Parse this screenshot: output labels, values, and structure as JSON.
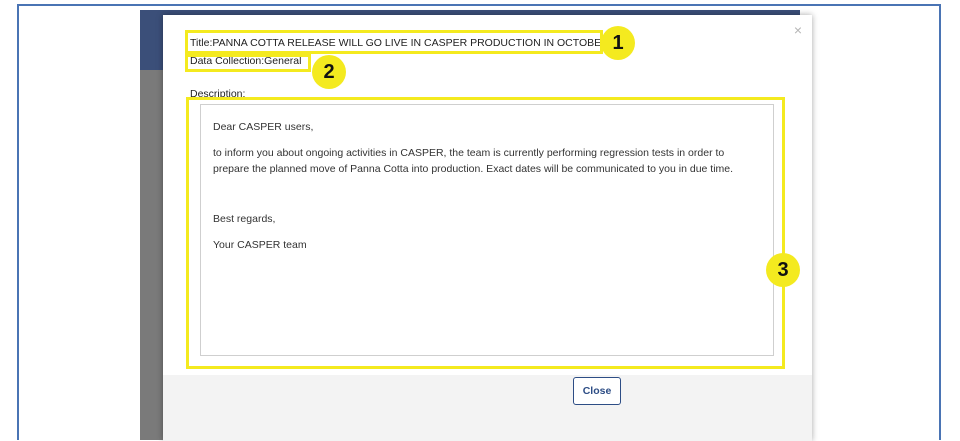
{
  "notice": {
    "title_prefix": "Title:",
    "title_value": "PANNA COTTA RELEASE WILL GO LIVE IN CASPER PRODUCTION IN OCTOBER",
    "data_collection_prefix": "Data Collection:",
    "data_collection_value": "General",
    "description_label": "Description:",
    "description": {
      "greeting": "Dear CASPER users,",
      "body": "to inform you about ongoing activities in CASPER, the team is currently performing regression tests in order to prepare the planned move of Panna Cotta into production. Exact dates will be communicated to you in due time.",
      "closing": "Best regards,",
      "signature": "Your CASPER team"
    }
  },
  "footer": {
    "close_label": "Close"
  },
  "dismiss_glyph": "×",
  "annotations": [
    {
      "label": "1"
    },
    {
      "label": "2"
    },
    {
      "label": "3"
    }
  ],
  "colors": {
    "highlight": "#f4ea1f",
    "frame": "#4a74b4",
    "button": "#2d4d85"
  }
}
